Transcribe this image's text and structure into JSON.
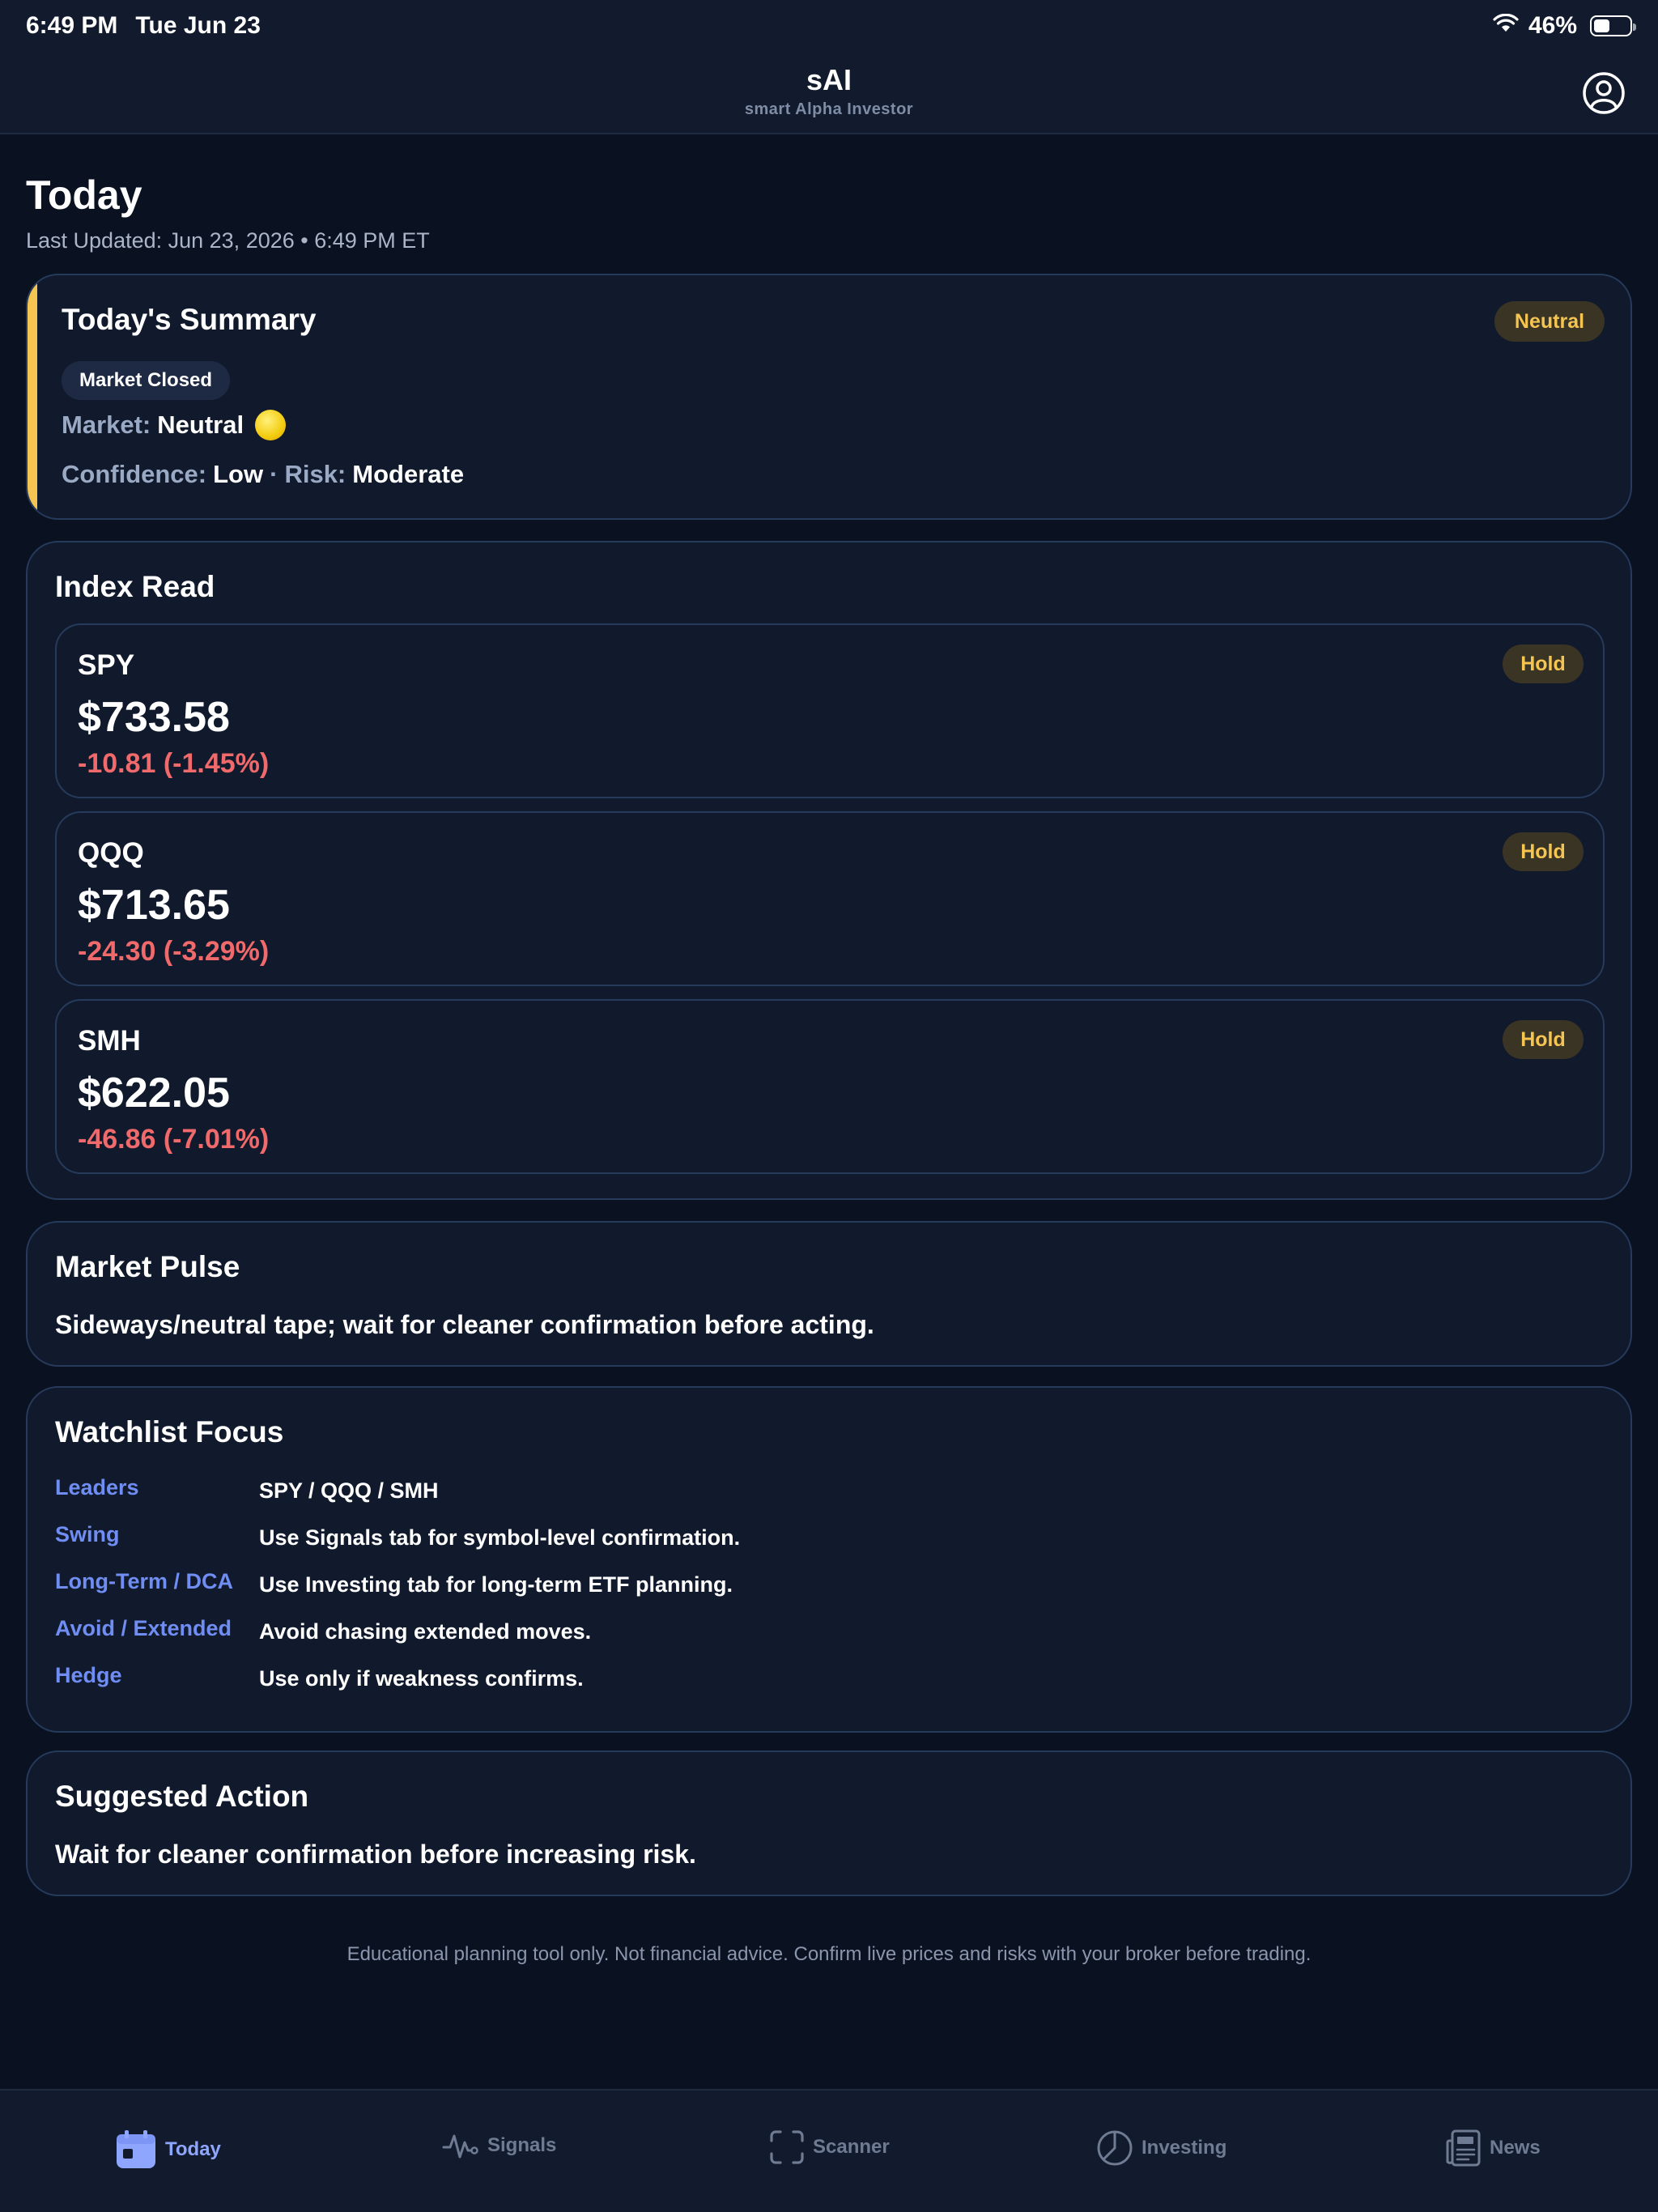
{
  "status_bar": {
    "time": "6:49 PM",
    "date": "Tue Jun 23",
    "battery_percent": "46%",
    "battery_level": 0.46
  },
  "header": {
    "title": "sAI",
    "subtitle": "smart Alpha Investor",
    "profile_icon": "person-circle-icon"
  },
  "page": {
    "title": "Today",
    "last_updated": "Last Updated: Jun 23, 2026 • 6:49 PM ET"
  },
  "summary": {
    "title": "Today's Summary",
    "badge": "Neutral",
    "market_status": "Market Closed",
    "market_label": "Market:",
    "market_value": "Neutral",
    "confidence_label": "Confidence:",
    "confidence_value": "Low",
    "separator": "·",
    "risk_label": "Risk:",
    "risk_value": "Moderate",
    "accent_color": "#f5c451"
  },
  "index_read": {
    "title": "Index Read",
    "items": [
      {
        "symbol": "SPY",
        "price": "$733.58",
        "change": "-10.81 (-1.45%)",
        "badge": "Hold"
      },
      {
        "symbol": "QQQ",
        "price": "$713.65",
        "change": "-24.30 (-3.29%)",
        "badge": "Hold"
      },
      {
        "symbol": "SMH",
        "price": "$622.05",
        "change": "-46.86 (-7.01%)",
        "badge": "Hold"
      }
    ]
  },
  "market_pulse": {
    "title": "Market Pulse",
    "text": "Sideways/neutral tape; wait for cleaner confirmation before acting."
  },
  "watchlist": {
    "title": "Watchlist Focus",
    "rows": [
      {
        "key": "Leaders",
        "value": "SPY / QQQ / SMH"
      },
      {
        "key": "Swing",
        "value": "Use Signals tab for symbol-level confirmation."
      },
      {
        "key": "Long-Term / DCA",
        "value": "Use Investing tab for long-term ETF planning."
      },
      {
        "key": "Avoid / Extended",
        "value": "Avoid chasing extended moves."
      },
      {
        "key": "Hedge",
        "value": "Use only if weakness confirms."
      }
    ]
  },
  "suggested_action": {
    "title": "Suggested Action",
    "text": "Wait for cleaner confirmation before increasing risk."
  },
  "disclaimer": "Educational planning tool only. Not financial advice. Confirm live prices and risks with your broker before trading.",
  "tabs": [
    {
      "label": "Today",
      "icon": "calendar-icon",
      "active": true
    },
    {
      "label": "Signals",
      "icon": "pulse-icon",
      "active": false
    },
    {
      "label": "Scanner",
      "icon": "scanner-icon",
      "active": false
    },
    {
      "label": "Investing",
      "icon": "pie-chart-icon",
      "active": false
    },
    {
      "label": "News",
      "icon": "newspaper-icon",
      "active": false
    }
  ],
  "colors": {
    "background": "#0a1120",
    "card": "#111a2c",
    "border": "#263a5c",
    "accent_yellow": "#f5c451",
    "negative_red": "#f0696b",
    "label_blue": "#6f8df2",
    "active_tab": "#8fa6ff"
  }
}
